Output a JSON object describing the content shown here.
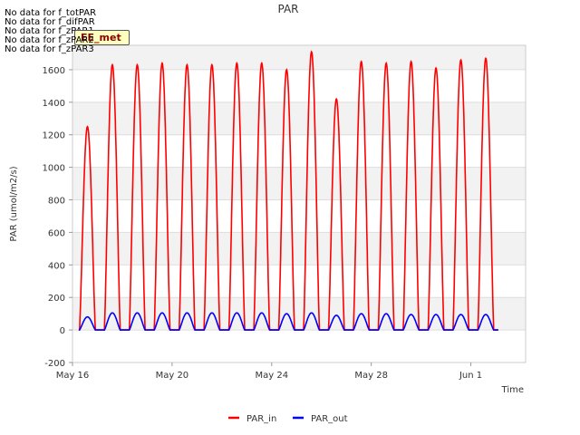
{
  "chart_data": {
    "type": "line",
    "title": "PAR",
    "xlabel": "Time",
    "ylabel": "PAR (umol/m2/s)",
    "ylim": [
      -200,
      1750
    ],
    "yticks": [
      -200,
      0,
      200,
      400,
      600,
      800,
      1000,
      1200,
      1400,
      1600
    ],
    "x_tick_labels": [
      "May 16",
      "May 20",
      "May 24",
      "May 28",
      "Jun 1"
    ],
    "x_tick_days": [
      0,
      4,
      8,
      12,
      16
    ],
    "x_range_days": [
      0,
      18.2
    ],
    "grid": true,
    "legend_position": "bottom-center",
    "series": [
      {
        "name": "PAR_in",
        "color": "#ff0000",
        "days": [
          0.6,
          1.6,
          2.6,
          3.6,
          4.6,
          5.6,
          6.6,
          7.6,
          8.6,
          9.6,
          10.6,
          11.6,
          12.6,
          13.6,
          14.6,
          15.6,
          16.6
        ],
        "daily_peak": [
          1250,
          1630,
          1630,
          1640,
          1630,
          1630,
          1640,
          1640,
          1600,
          1710,
          1420,
          1650,
          1640,
          1650,
          1610,
          1660,
          1670
        ]
      },
      {
        "name": "PAR_out",
        "color": "#0000ff",
        "days": [
          0.6,
          1.6,
          2.6,
          3.6,
          4.6,
          5.6,
          6.6,
          7.6,
          8.6,
          9.6,
          10.6,
          11.6,
          12.6,
          13.6,
          14.6,
          15.6,
          16.6
        ],
        "daily_peak": [
          80,
          105,
          105,
          105,
          105,
          105,
          105,
          105,
          100,
          105,
          90,
          100,
          100,
          95,
          95,
          95,
          95
        ]
      }
    ]
  },
  "no_data_notes": [
    "No data for f_totPAR",
    "No data for f_difPAR",
    "No data for f_zPAR1",
    "No data for f_zPAR2",
    "No data for f_zPAR3"
  ],
  "badge_label": "EE_met"
}
